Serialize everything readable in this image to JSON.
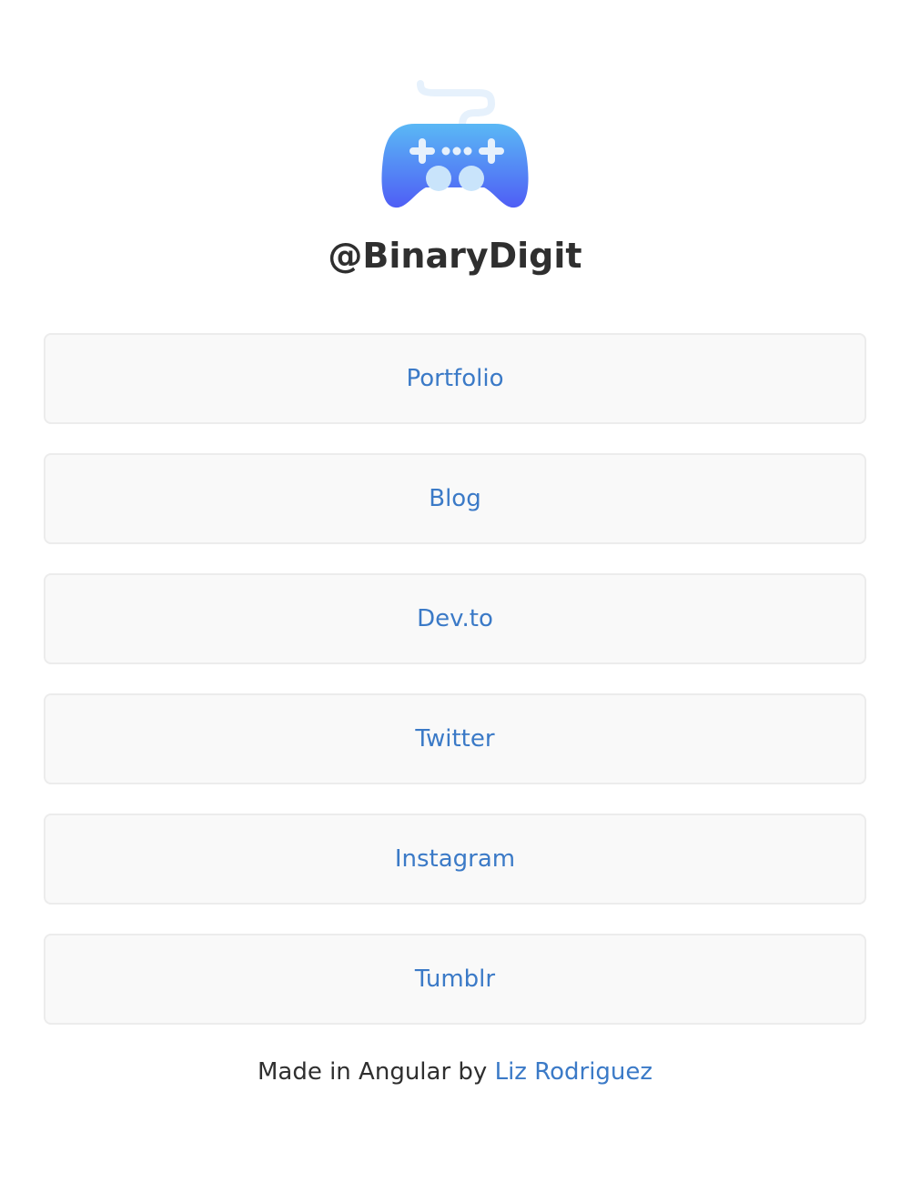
{
  "profile": {
    "logo_icon": "gamepad-icon",
    "handle": "@BinaryDigit"
  },
  "links": [
    {
      "label": "Portfolio"
    },
    {
      "label": "Blog"
    },
    {
      "label": "Dev.to"
    },
    {
      "label": "Twitter"
    },
    {
      "label": "Instagram"
    },
    {
      "label": "Tumblr"
    }
  ],
  "footer": {
    "prefix": "Made in Angular by",
    "author_link": "Liz Rodriguez"
  },
  "colors": {
    "link": "#3b7ac7",
    "text": "#2f2f2f",
    "button_bg": "#f9f9f9",
    "button_border": "#ececec",
    "logo_gradient_top": "#5ab8f5",
    "logo_gradient_bottom": "#4f5ef5"
  }
}
